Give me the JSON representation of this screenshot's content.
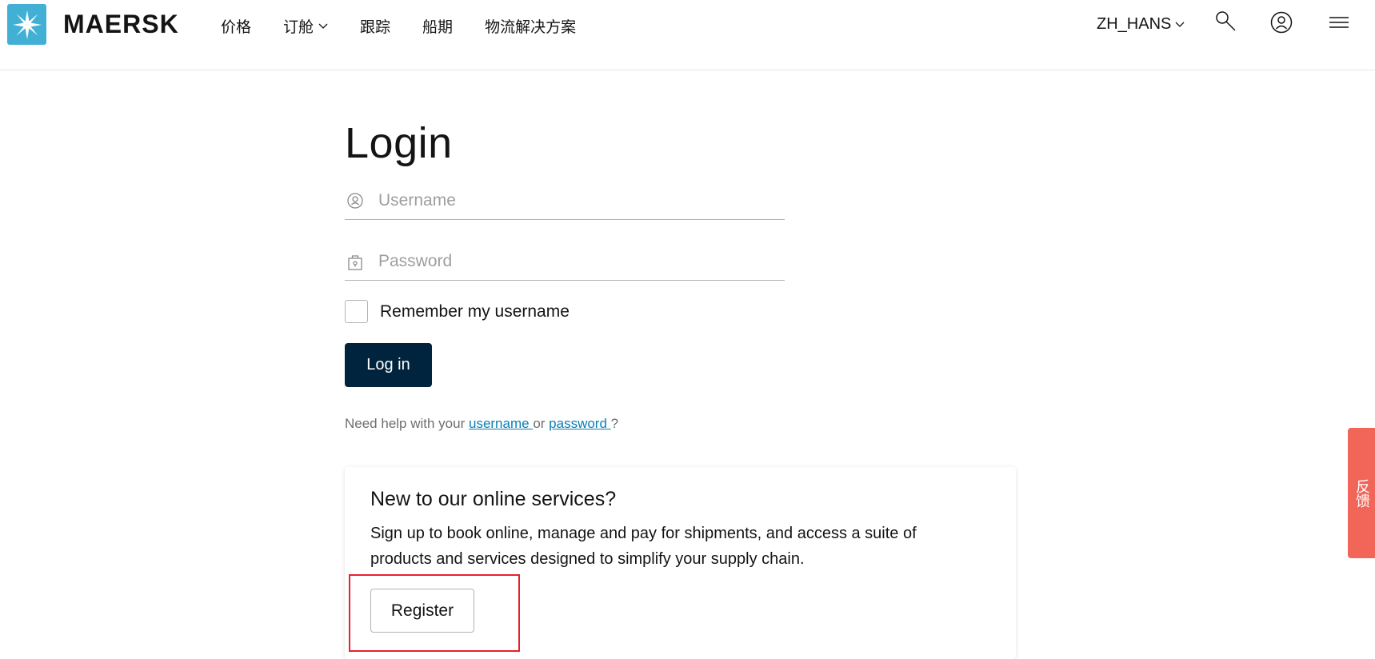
{
  "header": {
    "brand": "MAERSK",
    "nav": [
      {
        "label": "价格",
        "has_dropdown": false
      },
      {
        "label": "订舱",
        "has_dropdown": true
      },
      {
        "label": "跟踪",
        "has_dropdown": false
      },
      {
        "label": "船期",
        "has_dropdown": false
      },
      {
        "label": "物流解决方案",
        "has_dropdown": false
      }
    ],
    "language": "ZH_HANS",
    "icons": [
      "search-icon",
      "account-icon",
      "menu-icon"
    ]
  },
  "login": {
    "title": "Login",
    "username_placeholder": "Username",
    "password_placeholder": "Password",
    "remember_label": "Remember my username",
    "remember_checked": false,
    "login_button": "Log in",
    "help_prefix": "Need help with your ",
    "help_username_link": "username ",
    "help_or": "or ",
    "help_password_link": "password ",
    "help_suffix": "?"
  },
  "register_card": {
    "title": "New to our online services?",
    "text": "Sign up to book online, manage and pay for shipments, and access a suite of products and services designed to simplify your supply chain.",
    "button": "Register"
  },
  "feedback": {
    "label": "反馈"
  },
  "colors": {
    "brand_blue": "#42b0d5",
    "primary_button": "#00243d",
    "link": "#0b7eb4",
    "highlight": "#e8202e",
    "feedback": "#f2665a"
  }
}
